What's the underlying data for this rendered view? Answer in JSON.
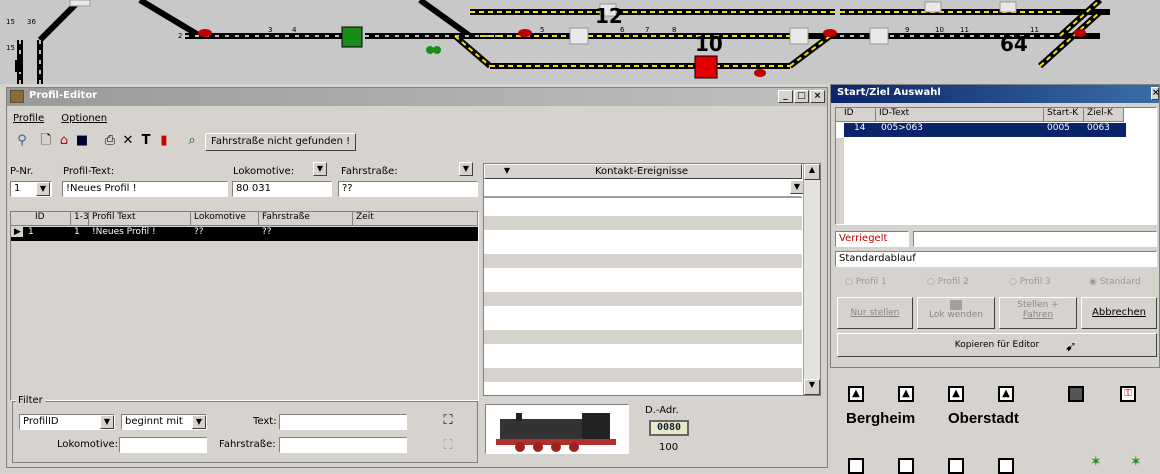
{
  "track": {
    "numbers_large": [
      "12",
      "10",
      "64"
    ],
    "numbers_small": [
      "15",
      "36",
      "15",
      "2",
      "3",
      "4",
      "5",
      "6",
      "7",
      "8",
      "9",
      "10",
      "11",
      "11"
    ]
  },
  "profil_editor": {
    "title": "Profil-Editor",
    "menu": [
      {
        "label": "Profile"
      },
      {
        "label": "Optionen"
      }
    ],
    "status": "Fahrstraße nicht gefunden !",
    "labels": {
      "pnr": "P-Nr.",
      "profiltext": "Profil-Text:",
      "lokomotive": "Lokomotive:",
      "fahrstrasse": "Fahrstraße:"
    },
    "values": {
      "pnr": "1",
      "profiltext": "!Neues Profil !",
      "lokomotive": "80 031",
      "fahrstrasse": "??"
    },
    "table": {
      "columns": [
        "ID",
        "1-3",
        "Profil Text",
        "Lokomotive",
        "Fahrstraße",
        "Zeit"
      ],
      "rows": [
        {
          "id": "1",
          "c13": "1",
          "text": "!Neues Profil !",
          "lok": "??",
          "fs": "??",
          "zeit": ""
        }
      ]
    },
    "kontakt_header": "Kontakt-Ereignisse",
    "filter": {
      "legend": "Filter",
      "field": "ProfilID",
      "mode": "beginnt mit",
      "text_label": "Text:",
      "lok_label": "Lokomotive:",
      "fs_label": "Fahrstraße:"
    },
    "loco": {
      "addr_label": "D.-Adr.",
      "addr": "0080",
      "speed": "100"
    }
  },
  "start_ziel": {
    "title": "Start/Ziel Auswahl",
    "columns": [
      "ID",
      "ID-Text",
      "Start-K",
      "Ziel-K"
    ],
    "rows": [
      {
        "id": "14",
        "text": "005>063",
        "start": "0005",
        "ziel": "0063"
      }
    ],
    "verriegelt": "Verriegelt",
    "ablauf": "Standardablauf",
    "radios": [
      "Profil 1",
      "Profil 2",
      "Profil 3",
      "Standard"
    ],
    "buttons": {
      "nur_stellen": "Nur stellen",
      "lok_wenden": "Lok wenden",
      "stellen_fahren_1": "Stellen +",
      "stellen_fahren_2": "Fahren",
      "abbrechen": "Abbrechen",
      "kopieren": "Kopieren für Editor"
    }
  },
  "stations": [
    "Bergheim",
    "Oberstadt"
  ],
  "colors": {
    "title_active": "#0a246a",
    "selection": "#0a246a",
    "signal_red": "#e00000",
    "signal_green": "#1a8c1a",
    "track_yellow": "#f0e000"
  }
}
